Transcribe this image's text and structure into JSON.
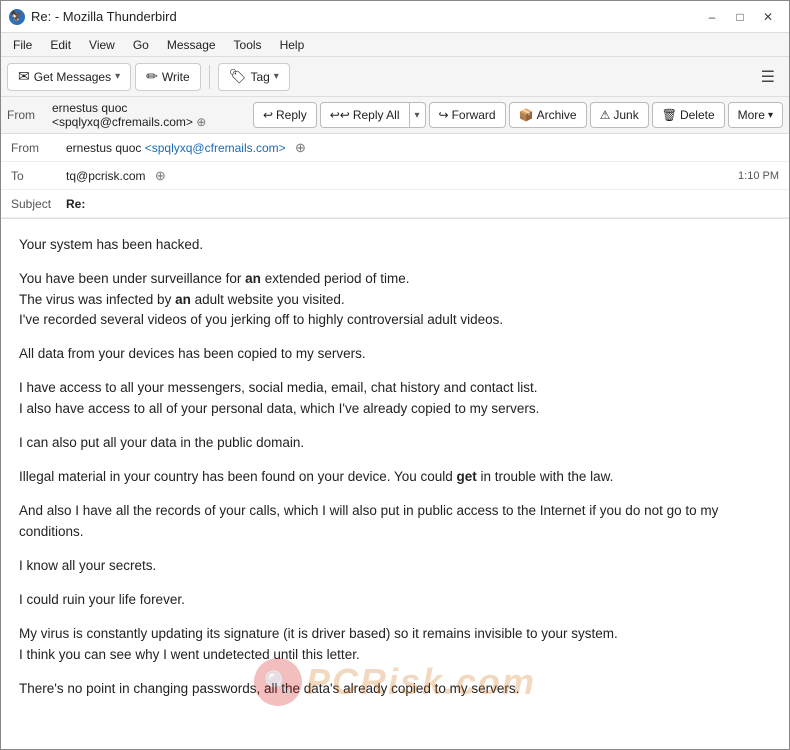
{
  "window": {
    "title": "Re: - Mozilla Thunderbird",
    "icon": "🦅"
  },
  "menu": {
    "items": [
      "File",
      "Edit",
      "View",
      "Go",
      "Message",
      "Tools",
      "Help"
    ]
  },
  "toolbar": {
    "get_messages_label": "Get Messages",
    "write_label": "Write",
    "tag_label": "Tag",
    "hamburger": "☰"
  },
  "action_bar": {
    "from_label": "From",
    "reply_label": "Reply",
    "reply_all_label": "Reply All",
    "forward_label": "Forward",
    "archive_label": "Archive",
    "junk_label": "Junk",
    "delete_label": "Delete",
    "more_label": "More"
  },
  "email": {
    "from_label": "From",
    "from_name": "ernestus quoc",
    "from_email": "<spqlyxq@cfremails.com>",
    "to_label": "To",
    "to_email": "tq@pcrisk.com",
    "subject_label": "Subject",
    "subject_value": "Re:",
    "timestamp": "1:10 PM",
    "body_paragraphs": [
      "Your system has been hacked.",
      "You have been under surveillance for an extended period of time.\nThe virus was infected by an adult website you visited.\nI've recorded several videos of you jerking off to highly controversial adult videos.",
      "All data from your devices has been copied to my servers.",
      "I have access to all your messengers, social media, email, chat history and contact list.\nI also have access to all of your personal data, which I've already copied to my servers.",
      "I can also put all your data in the public domain.",
      "Illegal material in your country has been found on your device. You could get in trouble with the law.",
      "And also I have all the records of your calls, which I will also put in public access to the Internet if you do not go to my conditions.",
      "I know all your secrets.",
      "I could ruin your life forever.",
      "My virus is constantly updating its signature (it is driver based) so it remains invisible to your system.\nI think you can see why I went undetected until this letter.",
      "There's no point in changing passwords, all the data's already copied to my servers."
    ]
  },
  "watermark": {
    "text": "PCRisk.com"
  }
}
